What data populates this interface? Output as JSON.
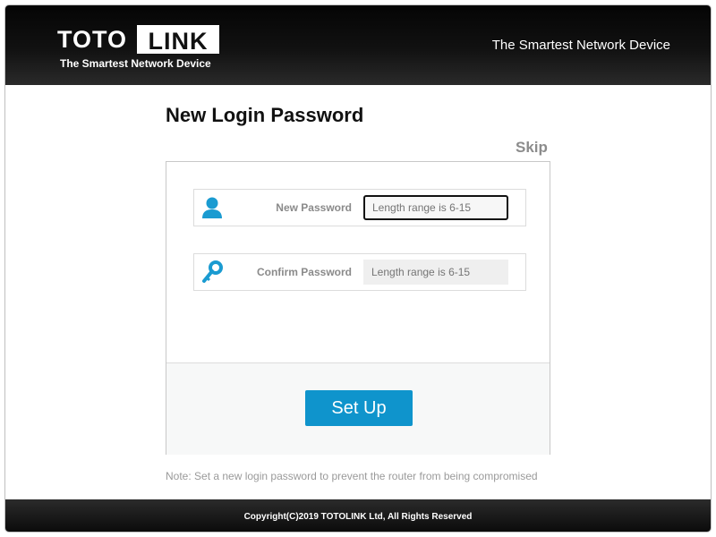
{
  "header": {
    "logo_left": "TOTO",
    "logo_right": "LINK",
    "logo_subtitle": "The Smartest Network Device",
    "tagline": "The Smartest Network Device"
  },
  "page": {
    "title": "New Login Password",
    "skip_label": "Skip"
  },
  "form": {
    "new_password": {
      "label": "New Password",
      "placeholder": "Length range is 6-15",
      "icon": "user-icon",
      "value": ""
    },
    "confirm_password": {
      "label": "Confirm Password",
      "placeholder": "Length range is 6-15",
      "icon": "key-icon",
      "value": ""
    },
    "setup_label": "Set Up"
  },
  "note": "Note: Set a new login password to prevent the router from being compromised",
  "footer": {
    "copyright": "Copyright(C)2019 TOTOLINK Ltd, All Rights Reserved"
  },
  "colors": {
    "accent": "#0f94cc",
    "header_bg": "#111111",
    "muted_text": "#8a8a8a"
  }
}
